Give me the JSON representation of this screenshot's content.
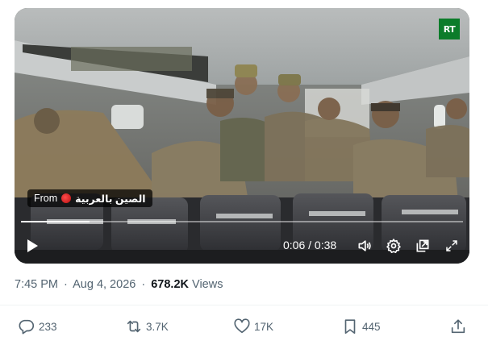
{
  "video": {
    "watermark": "RT",
    "source_prefix": "From",
    "source_name": "الصين بالعربية",
    "progress_fraction": 0.155,
    "time_current": "0:06",
    "time_separator": " / ",
    "time_total": "0:38",
    "controls": {
      "play_icon": "play-icon",
      "volume_icon": "volume-icon",
      "settings_icon": "gear-icon",
      "popout_icon": "popout-icon",
      "fullscreen_icon": "fullscreen-icon"
    }
  },
  "meta": {
    "time": "7:45 PM",
    "separator": "·",
    "date": "Aug 4, 2026",
    "views_count": "678.2K",
    "views_label": "Views"
  },
  "actions": {
    "replies": "233",
    "reposts": "3.7K",
    "likes": "17K",
    "bookmarks": "445"
  },
  "colors": {
    "muted_text": "#536471",
    "primary_text": "#0f1419",
    "rt_green": "#0c7c2a"
  }
}
